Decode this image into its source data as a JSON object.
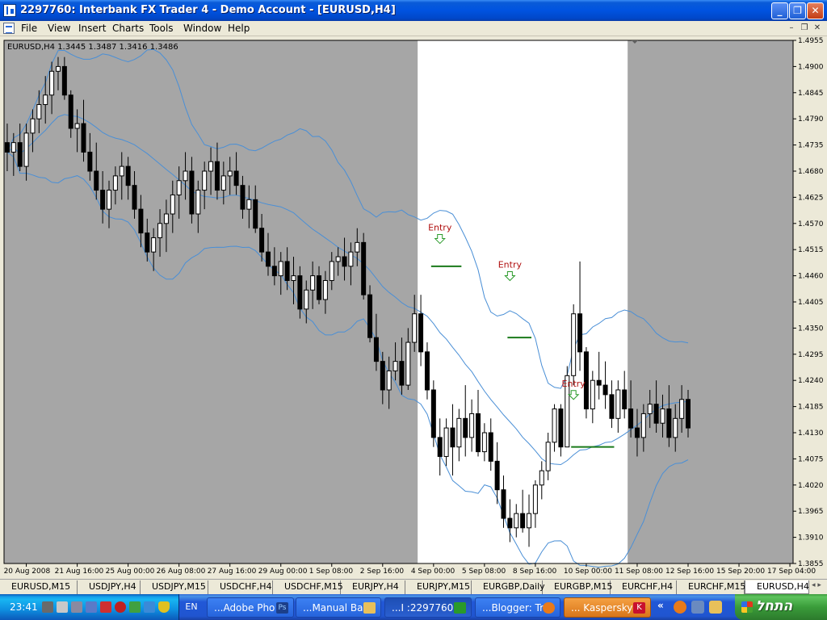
{
  "window": {
    "title": "2297760: Interbank FX Trader 4 - Demo Account - [EURUSD,H4]",
    "btn_minimize": "_",
    "btn_restore": "❐",
    "btn_close": "✕"
  },
  "menu": {
    "items": [
      "File",
      "View",
      "Insert",
      "Charts",
      "Tools",
      "Window",
      "Help"
    ],
    "mdi_minimize": "–",
    "mdi_restore": "❐",
    "mdi_close": "✕"
  },
  "chart_data": {
    "type": "candlestick",
    "symbol_header": "EURUSD,H4  1.3445 1.3487 1.3416 1.3486",
    "y_range": [
      1.3855,
      1.4955
    ],
    "y_ticks": [
      "1.4955",
      "1.4900",
      "1.4845",
      "1.4790",
      "1.4735",
      "1.4680",
      "1.4625",
      "1.4570",
      "1.4515",
      "1.4460",
      "1.4405",
      "1.4350",
      "1.4295",
      "1.4240",
      "1.4185",
      "1.4130",
      "1.4075",
      "1.4020",
      "1.3965",
      "1.3910",
      "1.3855"
    ],
    "x_ticks": [
      {
        "label": "20 Aug 2008",
        "bar": 3
      },
      {
        "label": "21 Aug 16:00",
        "bar": 11
      },
      {
        "label": "25 Aug 00:00",
        "bar": 19
      },
      {
        "label": "26 Aug 08:00",
        "bar": 27
      },
      {
        "label": "27 Aug 16:00",
        "bar": 35
      },
      {
        "label": "29 Aug 00:00",
        "bar": 43
      },
      {
        "label": "1 Sep 08:00",
        "bar": 51
      },
      {
        "label": "2 Sep 16:00",
        "bar": 59
      },
      {
        "label": "4 Sep 00:00",
        "bar": 67
      },
      {
        "label": "5 Sep 08:00",
        "bar": 75
      },
      {
        "label": "8 Sep 16:00",
        "bar": 83
      },
      {
        "label": "10 Sep 00:00",
        "bar": 91
      },
      {
        "label": "11 Sep 08:00",
        "bar": 99
      },
      {
        "label": "12 Sep 16:00",
        "bar": 107
      },
      {
        "label": "15 Sep 20:00",
        "bar": 115
      },
      {
        "label": "17 Sep 04:00",
        "bar": 123
      }
    ],
    "ohlc": [
      [
        1.474,
        1.478,
        1.468,
        1.472
      ],
      [
        1.472,
        1.476,
        1.467,
        1.474
      ],
      [
        1.474,
        1.478,
        1.468,
        1.469
      ],
      [
        1.469,
        1.478,
        1.466,
        1.476
      ],
      [
        1.476,
        1.481,
        1.472,
        1.479
      ],
      [
        1.479,
        1.485,
        1.476,
        1.482
      ],
      [
        1.482,
        1.488,
        1.478,
        1.484
      ],
      [
        1.484,
        1.491,
        1.48,
        1.489
      ],
      [
        1.489,
        1.492,
        1.485,
        1.49
      ],
      [
        1.49,
        1.492,
        1.483,
        1.484
      ],
      [
        1.484,
        1.485,
        1.475,
        1.477
      ],
      [
        1.477,
        1.481,
        1.472,
        1.478
      ],
      [
        1.478,
        1.483,
        1.47,
        1.472
      ],
      [
        1.472,
        1.476,
        1.466,
        1.468
      ],
      [
        1.468,
        1.474,
        1.462,
        1.464
      ],
      [
        1.464,
        1.468,
        1.457,
        1.46
      ],
      [
        1.46,
        1.466,
        1.456,
        1.464
      ],
      [
        1.464,
        1.469,
        1.461,
        1.467
      ],
      [
        1.467,
        1.472,
        1.462,
        1.469
      ],
      [
        1.469,
        1.471,
        1.462,
        1.465
      ],
      [
        1.465,
        1.468,
        1.458,
        1.46
      ],
      [
        1.46,
        1.463,
        1.452,
        1.455
      ],
      [
        1.455,
        1.458,
        1.449,
        1.451
      ],
      [
        1.451,
        1.456,
        1.447,
        1.454
      ],
      [
        1.454,
        1.46,
        1.45,
        1.457
      ],
      [
        1.457,
        1.462,
        1.451,
        1.459
      ],
      [
        1.459,
        1.466,
        1.455,
        1.463
      ],
      [
        1.463,
        1.469,
        1.458,
        1.466
      ],
      [
        1.466,
        1.472,
        1.462,
        1.468
      ],
      [
        1.468,
        1.471,
        1.457,
        1.459
      ],
      [
        1.459,
        1.466,
        1.455,
        1.464
      ],
      [
        1.464,
        1.47,
        1.46,
        1.468
      ],
      [
        1.468,
        1.473,
        1.463,
        1.47
      ],
      [
        1.47,
        1.474,
        1.462,
        1.464
      ],
      [
        1.464,
        1.47,
        1.461,
        1.467
      ],
      [
        1.467,
        1.471,
        1.463,
        1.468
      ],
      [
        1.468,
        1.472,
        1.463,
        1.465
      ],
      [
        1.465,
        1.467,
        1.458,
        1.46
      ],
      [
        1.46,
        1.465,
        1.456,
        1.462
      ],
      [
        1.462,
        1.465,
        1.455,
        1.456
      ],
      [
        1.456,
        1.459,
        1.449,
        1.451
      ],
      [
        1.451,
        1.455,
        1.446,
        1.448
      ],
      [
        1.448,
        1.452,
        1.444,
        1.446
      ],
      [
        1.446,
        1.451,
        1.442,
        1.449
      ],
      [
        1.449,
        1.452,
        1.443,
        1.445
      ],
      [
        1.445,
        1.45,
        1.44,
        1.446
      ],
      [
        1.446,
        1.448,
        1.437,
        1.439
      ],
      [
        1.439,
        1.445,
        1.436,
        1.443
      ],
      [
        1.443,
        1.449,
        1.439,
        1.446
      ],
      [
        1.446,
        1.448,
        1.44,
        1.441
      ],
      [
        1.441,
        1.447,
        1.438,
        1.445
      ],
      [
        1.445,
        1.451,
        1.443,
        1.449
      ],
      [
        1.449,
        1.452,
        1.446,
        1.45
      ],
      [
        1.45,
        1.454,
        1.445,
        1.448
      ],
      [
        1.448,
        1.453,
        1.444,
        1.451
      ],
      [
        1.451,
        1.456,
        1.448,
        1.453
      ],
      [
        1.453,
        1.455,
        1.441,
        1.442
      ],
      [
        1.442,
        1.444,
        1.432,
        1.433
      ],
      [
        1.433,
        1.438,
        1.426,
        1.428
      ],
      [
        1.428,
        1.43,
        1.419,
        1.422
      ],
      [
        1.422,
        1.429,
        1.418,
        1.426
      ],
      [
        1.426,
        1.432,
        1.424,
        1.428
      ],
      [
        1.428,
        1.433,
        1.421,
        1.423
      ],
      [
        1.423,
        1.435,
        1.422,
        1.432
      ],
      [
        1.432,
        1.442,
        1.43,
        1.438
      ],
      [
        1.438,
        1.442,
        1.427,
        1.43
      ],
      [
        1.43,
        1.432,
        1.42,
        1.422
      ],
      [
        1.422,
        1.424,
        1.41,
        1.412
      ],
      [
        1.412,
        1.416,
        1.404,
        1.408
      ],
      [
        1.408,
        1.416,
        1.406,
        1.414
      ],
      [
        1.414,
        1.419,
        1.404,
        1.41
      ],
      [
        1.41,
        1.418,
        1.407,
        1.416
      ],
      [
        1.416,
        1.423,
        1.408,
        1.412
      ],
      [
        1.412,
        1.42,
        1.409,
        1.417
      ],
      [
        1.417,
        1.422,
        1.408,
        1.409
      ],
      [
        1.409,
        1.415,
        1.407,
        1.413
      ],
      [
        1.413,
        1.416,
        1.405,
        1.407
      ],
      [
        1.407,
        1.411,
        1.398,
        1.401
      ],
      [
        1.401,
        1.404,
        1.393,
        1.395
      ],
      [
        1.395,
        1.399,
        1.39,
        1.393
      ],
      [
        1.393,
        1.398,
        1.391,
        1.396
      ],
      [
        1.396,
        1.401,
        1.392,
        1.393
      ],
      [
        1.393,
        1.4,
        1.389,
        1.396
      ],
      [
        1.396,
        1.403,
        1.393,
        1.402
      ],
      [
        1.402,
        1.407,
        1.399,
        1.405
      ],
      [
        1.405,
        1.413,
        1.403,
        1.411
      ],
      [
        1.411,
        1.419,
        1.409,
        1.418
      ],
      [
        1.418,
        1.419,
        1.408,
        1.41
      ],
      [
        1.41,
        1.427,
        1.41,
        1.425
      ],
      [
        1.425,
        1.44,
        1.423,
        1.438
      ],
      [
        1.438,
        1.449,
        1.426,
        1.43
      ],
      [
        1.43,
        1.431,
        1.416,
        1.418
      ],
      [
        1.418,
        1.426,
        1.415,
        1.424
      ],
      [
        1.424,
        1.43,
        1.42,
        1.423
      ],
      [
        1.423,
        1.428,
        1.418,
        1.421
      ],
      [
        1.421,
        1.424,
        1.414,
        1.416
      ],
      [
        1.416,
        1.424,
        1.413,
        1.422
      ],
      [
        1.422,
        1.426,
        1.416,
        1.418
      ],
      [
        1.418,
        1.424,
        1.412,
        1.414
      ],
      [
        1.414,
        1.418,
        1.408,
        1.412
      ],
      [
        1.412,
        1.419,
        1.409,
        1.417
      ],
      [
        1.417,
        1.422,
        1.414,
        1.419
      ],
      [
        1.419,
        1.424,
        1.413,
        1.415
      ],
      [
        1.415,
        1.421,
        1.412,
        1.418
      ],
      [
        1.418,
        1.423,
        1.41,
        1.412
      ],
      [
        1.412,
        1.419,
        1.409,
        1.416
      ],
      [
        1.416,
        1.423,
        1.413,
        1.42
      ],
      [
        1.42,
        1.422,
        1.412,
        1.414
      ]
    ],
    "indicator": "Bollinger Bands",
    "highlight_region": {
      "from_bar": 65,
      "to_bar": 98
    },
    "annotations": [
      {
        "label": "Entry",
        "bar": 68,
        "price": 1.4528,
        "color": "#b01010",
        "arrow_color": "#2a9a2a"
      },
      {
        "label": "Entry",
        "bar": 79,
        "price": 1.445,
        "color": "#b01010",
        "arrow_color": "#2a9a2a"
      },
      {
        "label": "Entry",
        "bar": 89,
        "price": 1.42,
        "color": "#b01010",
        "arrow_color": "#2a9a2a"
      }
    ],
    "entry_lines": [
      {
        "from_bar": 67,
        "to_bar": 71,
        "price": 1.448
      },
      {
        "from_bar": 79,
        "to_bar": 82,
        "price": 1.433
      },
      {
        "from_bar": 89,
        "to_bar": 95,
        "price": 1.41
      }
    ],
    "colors": {
      "background": "#a6a6a6",
      "highlight": "#ffffff",
      "band": "#4a8fd6",
      "bull_fill": "#ffffff",
      "bear_fill": "#000000",
      "entry_line": "#1a7a1a"
    }
  },
  "symbol_tabs": [
    "EURUSD,M15",
    "USDJPY,H4",
    "USDJPY,M15",
    "USDCHF,H4",
    "USDCHF,M15",
    "EURJPY,H4",
    "EURJPY,M15",
    "EURGBP,Daily",
    "EURGBP,M15",
    "EURCHF,H4",
    "EURCHF,M15",
    "EURUSD,H4"
  ],
  "tab_scroll": "◂ ▸",
  "taskbar": {
    "clock": "23:41",
    "lang": "EN",
    "buttons": [
      {
        "label": "...Adobe Pho",
        "icon_label": "Ps"
      },
      {
        "label": "...Manual Bac"
      },
      {
        "label": "...I :2297760"
      },
      {
        "label": "...Blogger: Tr"
      },
      {
        "label": "... Kaspersky",
        "icon_label": "K"
      }
    ],
    "ql_arrow": "«",
    "start_label": "התחל"
  }
}
